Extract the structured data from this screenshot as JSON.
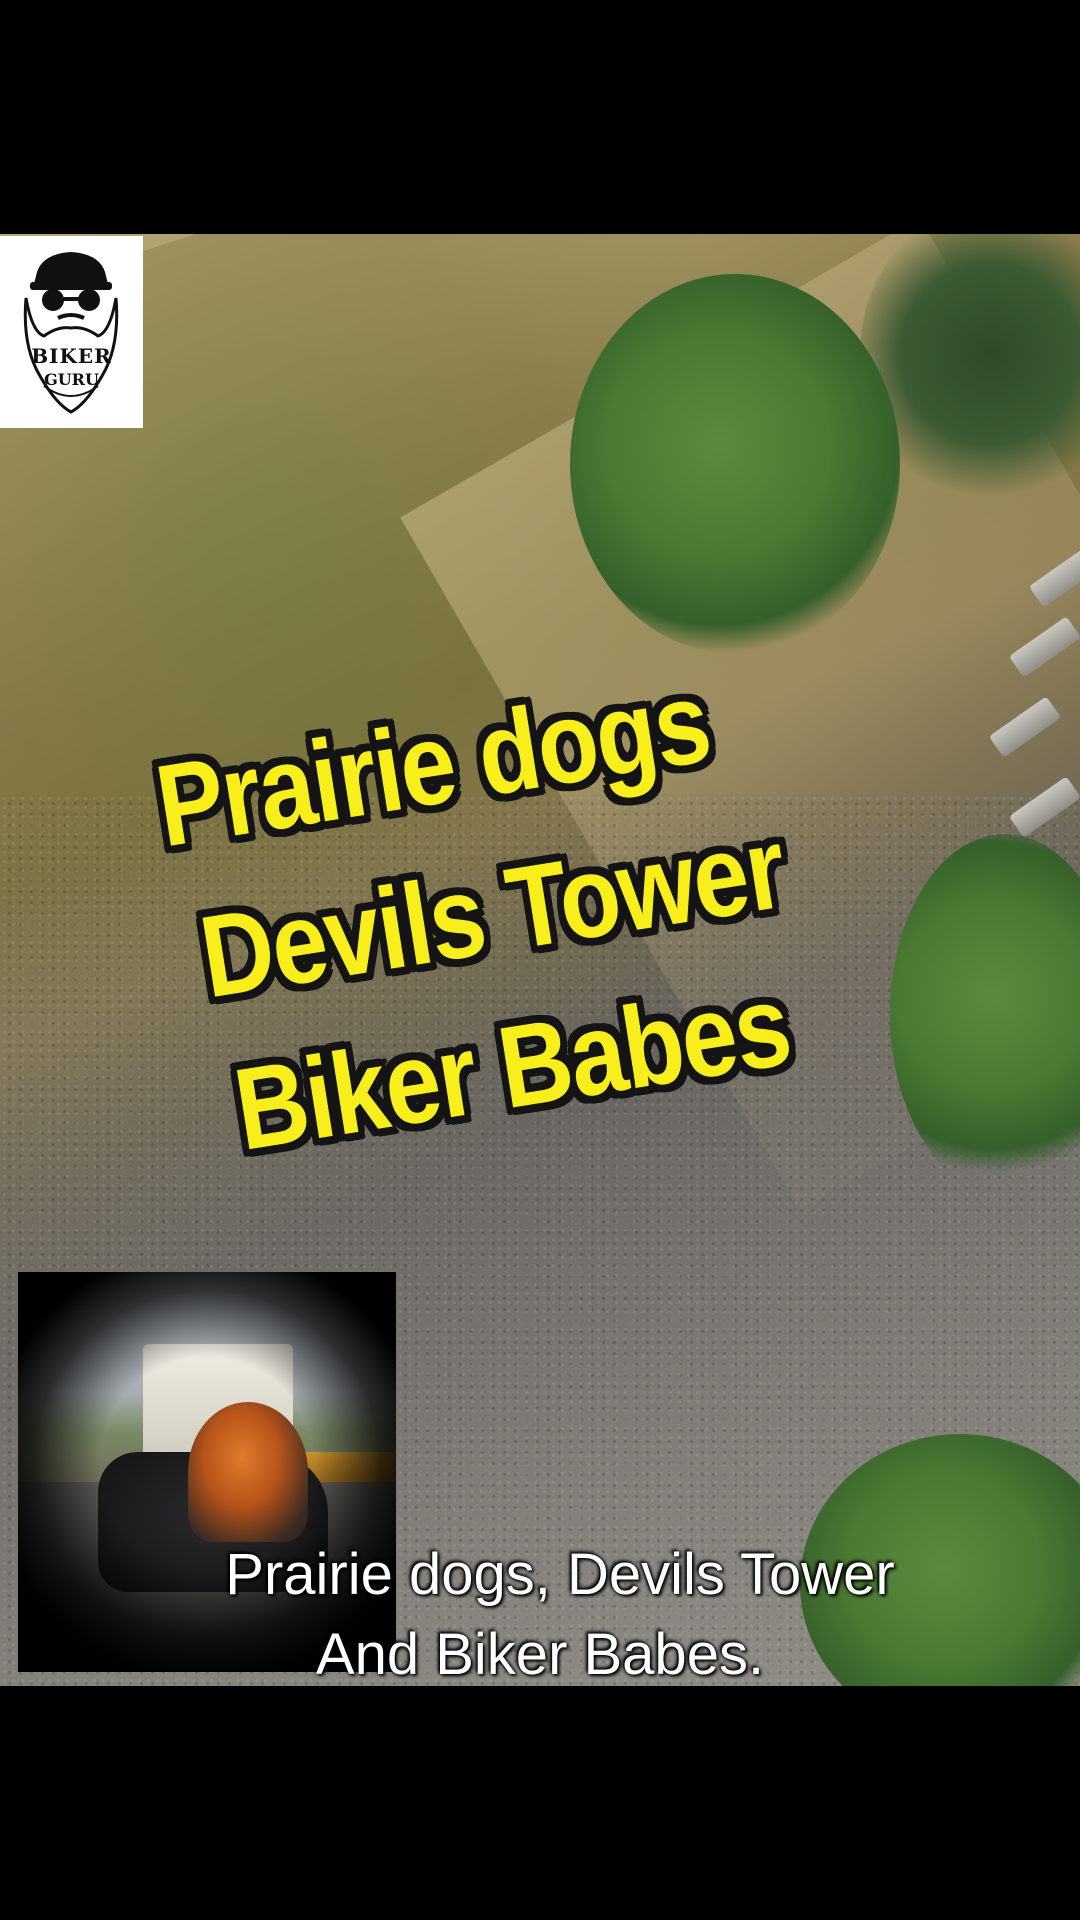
{
  "title_overlay": {
    "lines": [
      "Prairie dogs",
      "Devils Tower",
      "Biker Babes"
    ],
    "text_color": "#f7ee1c",
    "outline_color": "#141414"
  },
  "logo": {
    "line1": "BIKER",
    "line2": "GURU",
    "icon": "bearded-biker-icon"
  },
  "caption": {
    "line1": "Prairie dogs, Devils Tower",
    "line2": "And Biker Babes."
  },
  "inset": {
    "icon": "couple-on-motorcycle-photo"
  },
  "colors": {
    "letterbox": "#000000",
    "caption_text": "#ffffff"
  }
}
